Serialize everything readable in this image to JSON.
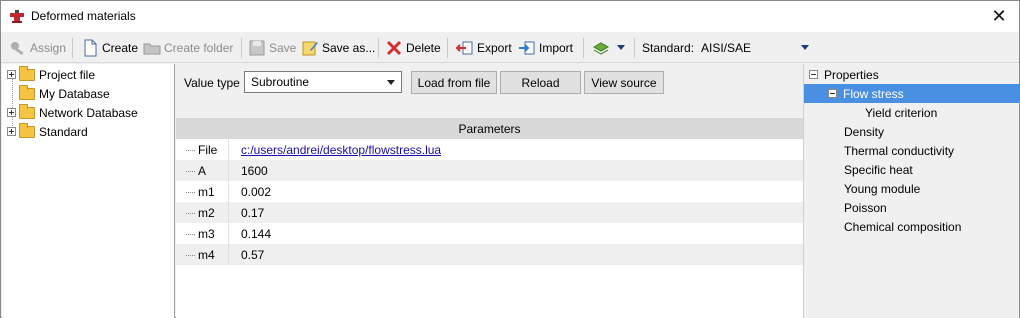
{
  "window": {
    "title": "Deformed materials",
    "close_glyph": "✕"
  },
  "toolbar": {
    "assign_label": "Assign",
    "create_label": "Create",
    "create_folder_label": "Create folder",
    "save_label": "Save",
    "save_as_label": "Save as...",
    "delete_label": "Delete",
    "export_label": "Export",
    "import_label": "Import",
    "standard_label": "Standard:",
    "standard_value": "AISI/SAE"
  },
  "tree": {
    "items": [
      {
        "label": "Project file",
        "expandable": true
      },
      {
        "label": "My Database",
        "expandable": false
      },
      {
        "label": "Network Database",
        "expandable": true
      },
      {
        "label": "Standard",
        "expandable": true
      }
    ]
  },
  "value_type": {
    "label": "Value type",
    "selected": "Subroutine",
    "load_button": "Load from file",
    "reload_button": "Reload",
    "view_source_button": "View source"
  },
  "parameters": {
    "header": "Parameters",
    "rows": [
      {
        "name": "File",
        "value": "c:/users/andrei/desktop/flowstress.lua"
      },
      {
        "name": "A",
        "value": "1600"
      },
      {
        "name": "m1",
        "value": "0.002"
      },
      {
        "name": "m2",
        "value": "0.17"
      },
      {
        "name": "m3",
        "value": "0.144"
      },
      {
        "name": "m4",
        "value": "0.57"
      }
    ]
  },
  "properties": {
    "root": "Properties",
    "selected": "Flow stress",
    "sub_item": "Yield criterion",
    "items": [
      "Density",
      "Thermal conductivity",
      "Specific heat",
      "Young module",
      "Poisson",
      "Chemical composition"
    ]
  },
  "colors": {
    "selection": "#4a90e2",
    "link": "#1a0dab",
    "folder": "#f4c542"
  }
}
